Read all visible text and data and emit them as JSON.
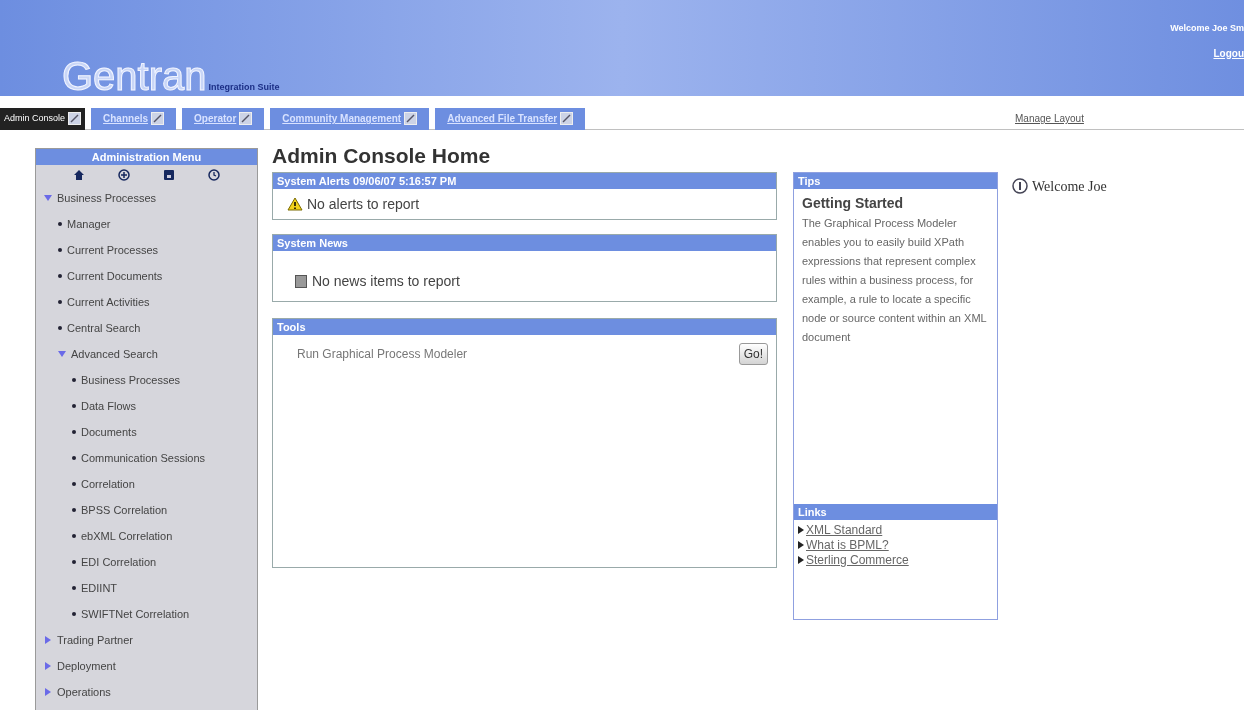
{
  "header": {
    "logo": "Gentran",
    "logo_subtitle": "Integration Suite",
    "welcome": "Welcome Joe Sm",
    "logout": "Logou"
  },
  "tabs": [
    {
      "label": "Admin Console",
      "selected": true
    },
    {
      "label": "Channels",
      "selected": false
    },
    {
      "label": "Operator",
      "selected": false
    },
    {
      "label": "Community Management",
      "selected": false
    },
    {
      "label": "Advanced File Transfer",
      "selected": false
    }
  ],
  "manage_layout": "Manage Layout",
  "sidebar": {
    "title": "Administration Menu",
    "items": [
      {
        "label": "Business Processes",
        "expanded": true,
        "children": [
          {
            "label": "Manager"
          },
          {
            "label": "Current Processes"
          },
          {
            "label": "Current Documents"
          },
          {
            "label": "Current Activities"
          },
          {
            "label": "Central Search"
          },
          {
            "label": "Advanced Search",
            "expanded": true,
            "children": [
              {
                "label": "Business Processes"
              },
              {
                "label": "Data Flows"
              },
              {
                "label": "Documents"
              },
              {
                "label": "Communication Sessions"
              },
              {
                "label": "Correlation"
              },
              {
                "label": "BPSS Correlation"
              },
              {
                "label": "ebXML Correlation"
              },
              {
                "label": "EDI Correlation"
              },
              {
                "label": "EDIINT"
              },
              {
                "label": "SWIFTNet Correlation"
              }
            ]
          }
        ]
      },
      {
        "label": "Trading Partner",
        "expanded": false
      },
      {
        "label": "Deployment",
        "expanded": false
      },
      {
        "label": "Operations",
        "expanded": false
      }
    ]
  },
  "page_title": "Admin Console Home",
  "alerts": {
    "title": "System Alerts 09/06/07 5:16:57 PM",
    "message": "No alerts to report"
  },
  "news": {
    "title": "System News",
    "message": "No news items to report"
  },
  "tools": {
    "title": "Tools",
    "items": [
      {
        "label": "Run Graphical Process Modeler",
        "button": "Go!"
      }
    ]
  },
  "tips": {
    "title": "Tips",
    "heading": "Getting Started",
    "text": "The Graphical Process Modeler enables you to easily build XPath expressions that represent complex rules within a business process, for example, a rule to locate a specific node or source content within an XML document"
  },
  "links": {
    "title": "Links",
    "items": [
      "XML Standard",
      "What is BPML?",
      "Sterling Commerce"
    ]
  },
  "welcome_panel": "Welcome Joe"
}
